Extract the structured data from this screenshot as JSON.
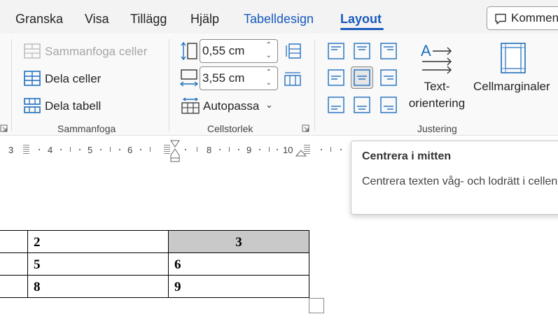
{
  "tabs": {
    "granska": "Granska",
    "visa": "Visa",
    "tillagg": "Tillägg",
    "hjalp": "Hjälp",
    "tabelldesign": "Tabelldesign",
    "layout": "Layout"
  },
  "comment_button": "Kommentarer",
  "ribbon": {
    "merge_cells": "Sammanfoga celler",
    "split_cells": "Dela celler",
    "split_table": "Dela tabell",
    "merge_group": "Sammanfoga",
    "height_value": "0,55 cm",
    "width_value": "3,55 cm",
    "autofit": "Autopassa",
    "cellsize_group": "Cellstorlek",
    "text_direction_1": "Text-",
    "text_direction_2": "orientering",
    "cell_margins": "Cellmarginaler",
    "alignment_group": "Justering"
  },
  "ruler": {
    "labels": [
      "3",
      "4",
      "5",
      "6",
      "8",
      "9",
      "10"
    ]
  },
  "tooltip": {
    "title": "Centrera i mitten",
    "body": "Centrera texten våg- och lodrätt i cellen."
  },
  "table": {
    "rows": [
      [
        "",
        "2",
        "3"
      ],
      [
        "",
        "5",
        "6"
      ],
      [
        "",
        "8",
        "9"
      ]
    ]
  },
  "colors": {
    "accent": "#185abd",
    "icon_blue": "#1f6fbf",
    "selected_cell": "#c9c9c9"
  }
}
